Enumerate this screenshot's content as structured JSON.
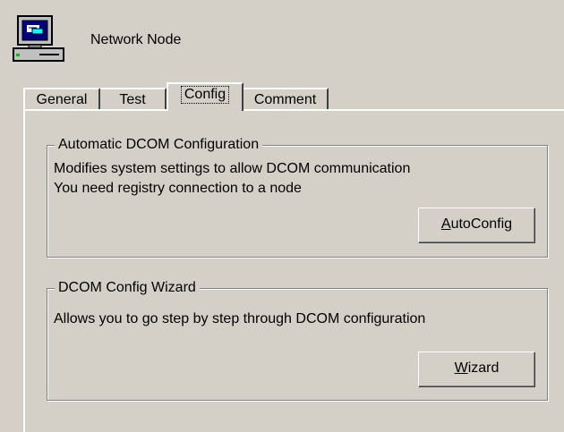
{
  "header": {
    "title": "Network Node",
    "icon": "network-computer-icon"
  },
  "tabs": [
    {
      "label": "General",
      "active": false
    },
    {
      "label": "Test",
      "active": false
    },
    {
      "label": "Config",
      "active": true
    },
    {
      "label": "Comment",
      "active": false
    }
  ],
  "dcom_group": {
    "title": "Automatic DCOM Configuration",
    "line1": "Modifies system settings to allow DCOM communication",
    "line2": "You need registry connection to a node",
    "button": {
      "mnemonic": "A",
      "rest": "utoConfig"
    }
  },
  "wizard_group": {
    "title": "DCOM Config Wizard",
    "line1": "Allows you to go step by step through DCOM configuration",
    "button": {
      "mnemonic": "W",
      "rest": "izard"
    }
  },
  "colors": {
    "face": "#d4d0c8",
    "monitor_screen": "#000080",
    "status_led": "#00c000"
  }
}
